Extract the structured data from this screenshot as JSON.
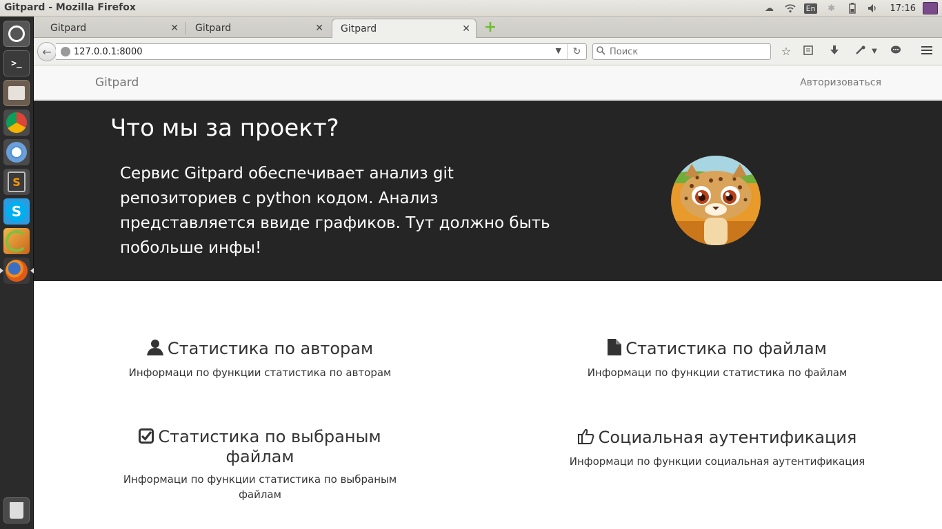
{
  "os": {
    "window_title": "Gitpard - Mozilla Firefox",
    "keyboard_layout": "En",
    "clock": "17:16",
    "launcher": [
      "dash-icon",
      "terminal-icon",
      "files-icon",
      "chrome-icon",
      "chromium-icon",
      "sublime-text-icon",
      "skype-icon",
      "spring-tool-suite-icon",
      "firefox-icon",
      "trash-icon"
    ]
  },
  "browser": {
    "tabs": [
      {
        "label": "Gitpard",
        "active": false
      },
      {
        "label": "Gitpard",
        "active": false
      },
      {
        "label": "Gitpard",
        "active": true
      }
    ],
    "url": "127.0.0.1:8000",
    "search_placeholder": "Поиск"
  },
  "site": {
    "brand": "Gitpard",
    "login": "Авторизоваться",
    "hero": {
      "title": "Что мы за проект?",
      "text": "Сервис Gitpard обеспечивает анализ git репозиториев с python кодом. Анализ представляется ввиде графиков. Тут должно быть побольше инфы!"
    },
    "features": [
      {
        "icon": "user-icon",
        "title": "Статистика по авторам",
        "desc": "Информаци по функции статистика по авторам"
      },
      {
        "icon": "file-icon",
        "title": "Статистика по файлам",
        "desc": "Информаци по функции статистика по файлам"
      },
      {
        "icon": "checkbox-icon",
        "title": "Статистика по выбраным файлам",
        "desc": "Информаци по функции статистика по выбраным файлам"
      },
      {
        "icon": "thumbs-up-icon",
        "title": "Социальная аутентификация",
        "desc": "Информаци по функции социальная аутентификация"
      }
    ]
  },
  "colors": {
    "hero_bg": "#252525",
    "navbar_bg": "#f8f8f8",
    "launcher_bg": "#2b2b2b"
  }
}
